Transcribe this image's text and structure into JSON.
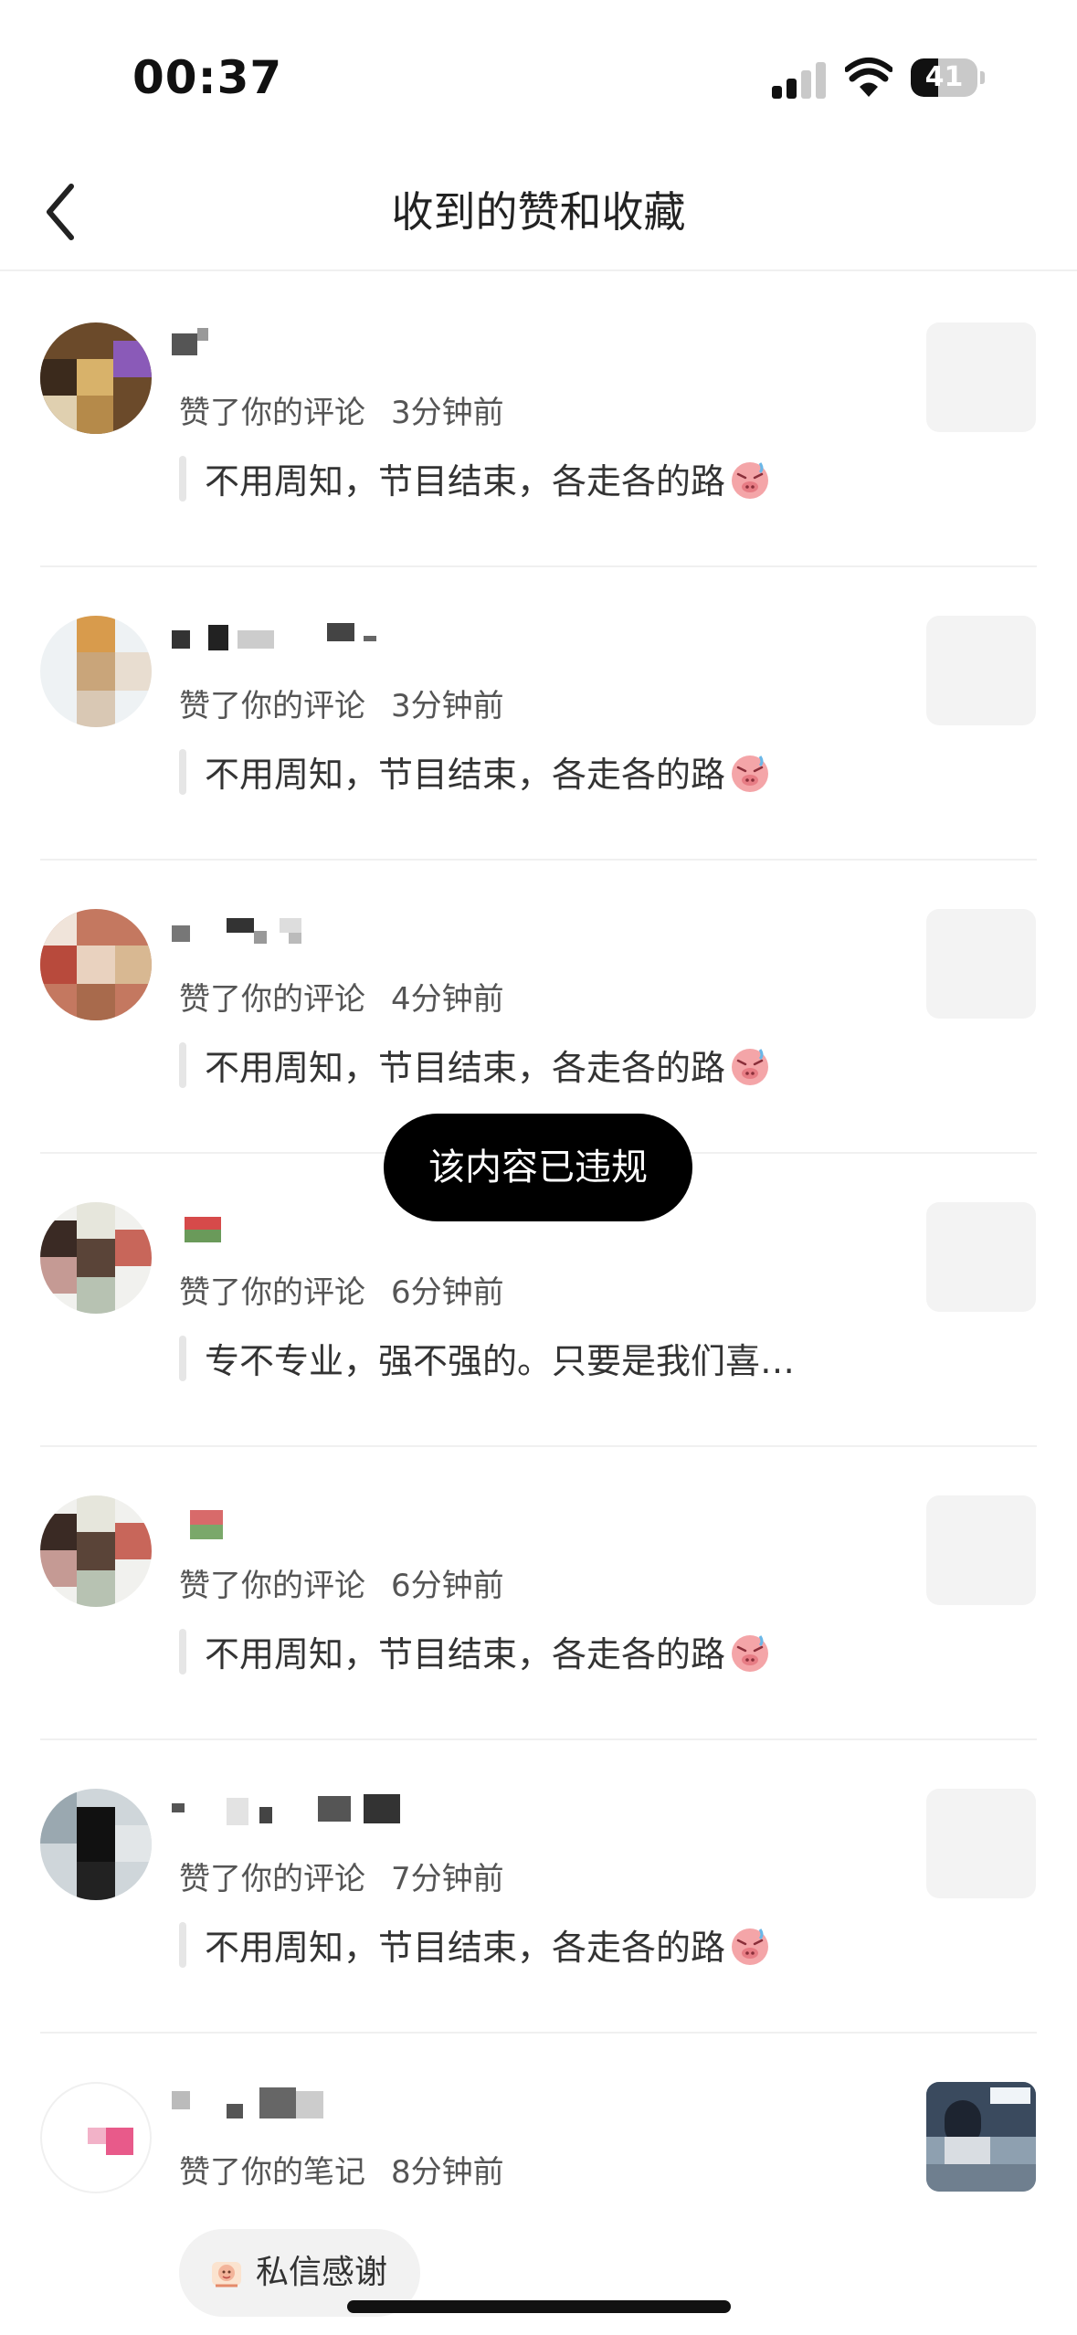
{
  "status_bar": {
    "time": "00:37",
    "battery_level": "41",
    "battery_fraction": 0.41
  },
  "header": {
    "title": "收到的赞和收藏"
  },
  "notifications": [
    {
      "action": "赞了你的评论",
      "time_ago": "3分钟前",
      "content": "不用周知，节目结束，各走各的路",
      "emoji": "crying-pig-emoji"
    },
    {
      "action": "赞了你的评论",
      "time_ago": "3分钟前",
      "content": "不用周知，节目结束，各走各的路",
      "emoji": "crying-pig-emoji"
    },
    {
      "action": "赞了你的评论",
      "time_ago": "4分钟前",
      "content": "不用周知，节目结束，各走各的路",
      "emoji": "crying-pig-emoji"
    },
    {
      "action": "赞了你的评论",
      "time_ago": "6分钟前",
      "content": "专不专业，强不强的。只要是我们喜…",
      "emoji": ""
    },
    {
      "action": "赞了你的评论",
      "time_ago": "6分钟前",
      "content": "不用周知，节目结束，各走各的路",
      "emoji": "crying-pig-emoji"
    },
    {
      "action": "赞了你的评论",
      "time_ago": "7分钟前",
      "content": "不用周知，节目结束，各走各的路",
      "emoji": "crying-pig-emoji"
    },
    {
      "action": "赞了你的笔记",
      "time_ago": "8分钟前",
      "content": "",
      "emoji": ""
    }
  ],
  "toast": {
    "text": "该内容已违规"
  },
  "dm_button": {
    "label": "私信感谢"
  }
}
